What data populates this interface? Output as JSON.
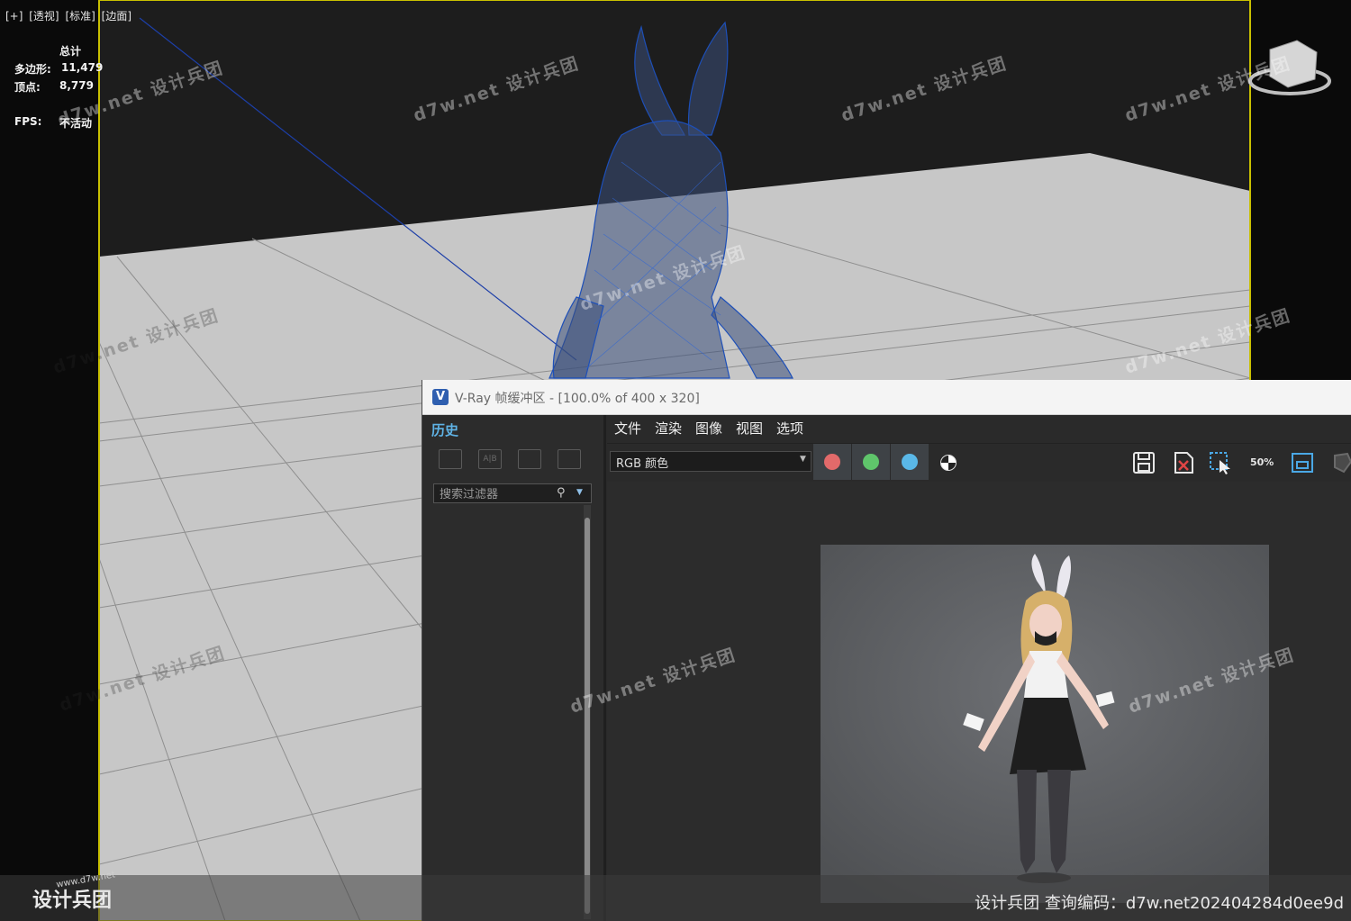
{
  "viewport": {
    "labels": [
      "[+]",
      "[透视]",
      "[标准]",
      "[边面]"
    ],
    "stats": {
      "header": "总计",
      "polys_label": "多边形:",
      "polys_value": "11,479",
      "verts_label": "顶点:",
      "verts_value": "8,779",
      "fps_label": "FPS:",
      "fps_value": "不活动"
    },
    "watermarks": [
      "d7w.net 设计兵团"
    ]
  },
  "vray_window": {
    "title": "V-Ray 帧缓冲区 - [100.0% of 400 x 320]",
    "logo_letter": "V",
    "history": {
      "tab_label": "历史",
      "search_placeholder": "搜索过滤器",
      "tool_icons": [
        "save-to-history-icon",
        "ab-compare-icon",
        "load-history-icon",
        "remove-history-icon"
      ],
      "ab_text": "A|B"
    },
    "menu": [
      "文件",
      "渲染",
      "图像",
      "视图",
      "选项"
    ],
    "channel_select": "RGB 颜色",
    "channel_buttons": [
      {
        "name": "red-channel",
        "color": "#e26a6a"
      },
      {
        "name": "green-channel",
        "color": "#5fc56b"
      },
      {
        "name": "blue-channel",
        "color": "#5ab8e8"
      }
    ],
    "zoom_label": "50%"
  },
  "footer": {
    "code_text": "设计兵团  查询编码：d7w.net202404284d0ee9d",
    "logo_text": "设计兵团",
    "logo_url": "www.d7w.net"
  },
  "colors": {
    "viewport_border": "#c9c000",
    "wireframe": "#1d4fb8",
    "history_tab": "#5fb3e6"
  }
}
